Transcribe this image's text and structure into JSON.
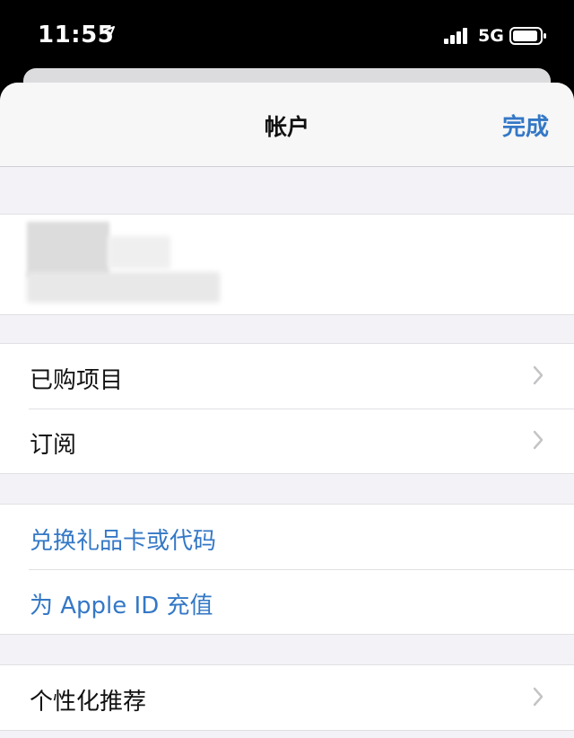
{
  "status_bar": {
    "time": "11:55",
    "network": "5G",
    "icons": [
      "location-arrow-icon",
      "signal-bars-icon",
      "battery-icon"
    ]
  },
  "nav": {
    "title": "帐户",
    "done_label": "完成"
  },
  "colors": {
    "accent": "#3478c6",
    "background": "#f2f2f7"
  },
  "groups": [
    {
      "items": [
        {
          "label": "已购项目",
          "chevron": true
        },
        {
          "label": "订阅",
          "chevron": true
        }
      ]
    },
    {
      "items": [
        {
          "label": "兑换礼品卡或代码",
          "link": true
        },
        {
          "label": "为 Apple ID 充值",
          "link": true
        }
      ]
    },
    {
      "items": [
        {
          "label": "个性化推荐",
          "chevron": true
        }
      ]
    }
  ]
}
